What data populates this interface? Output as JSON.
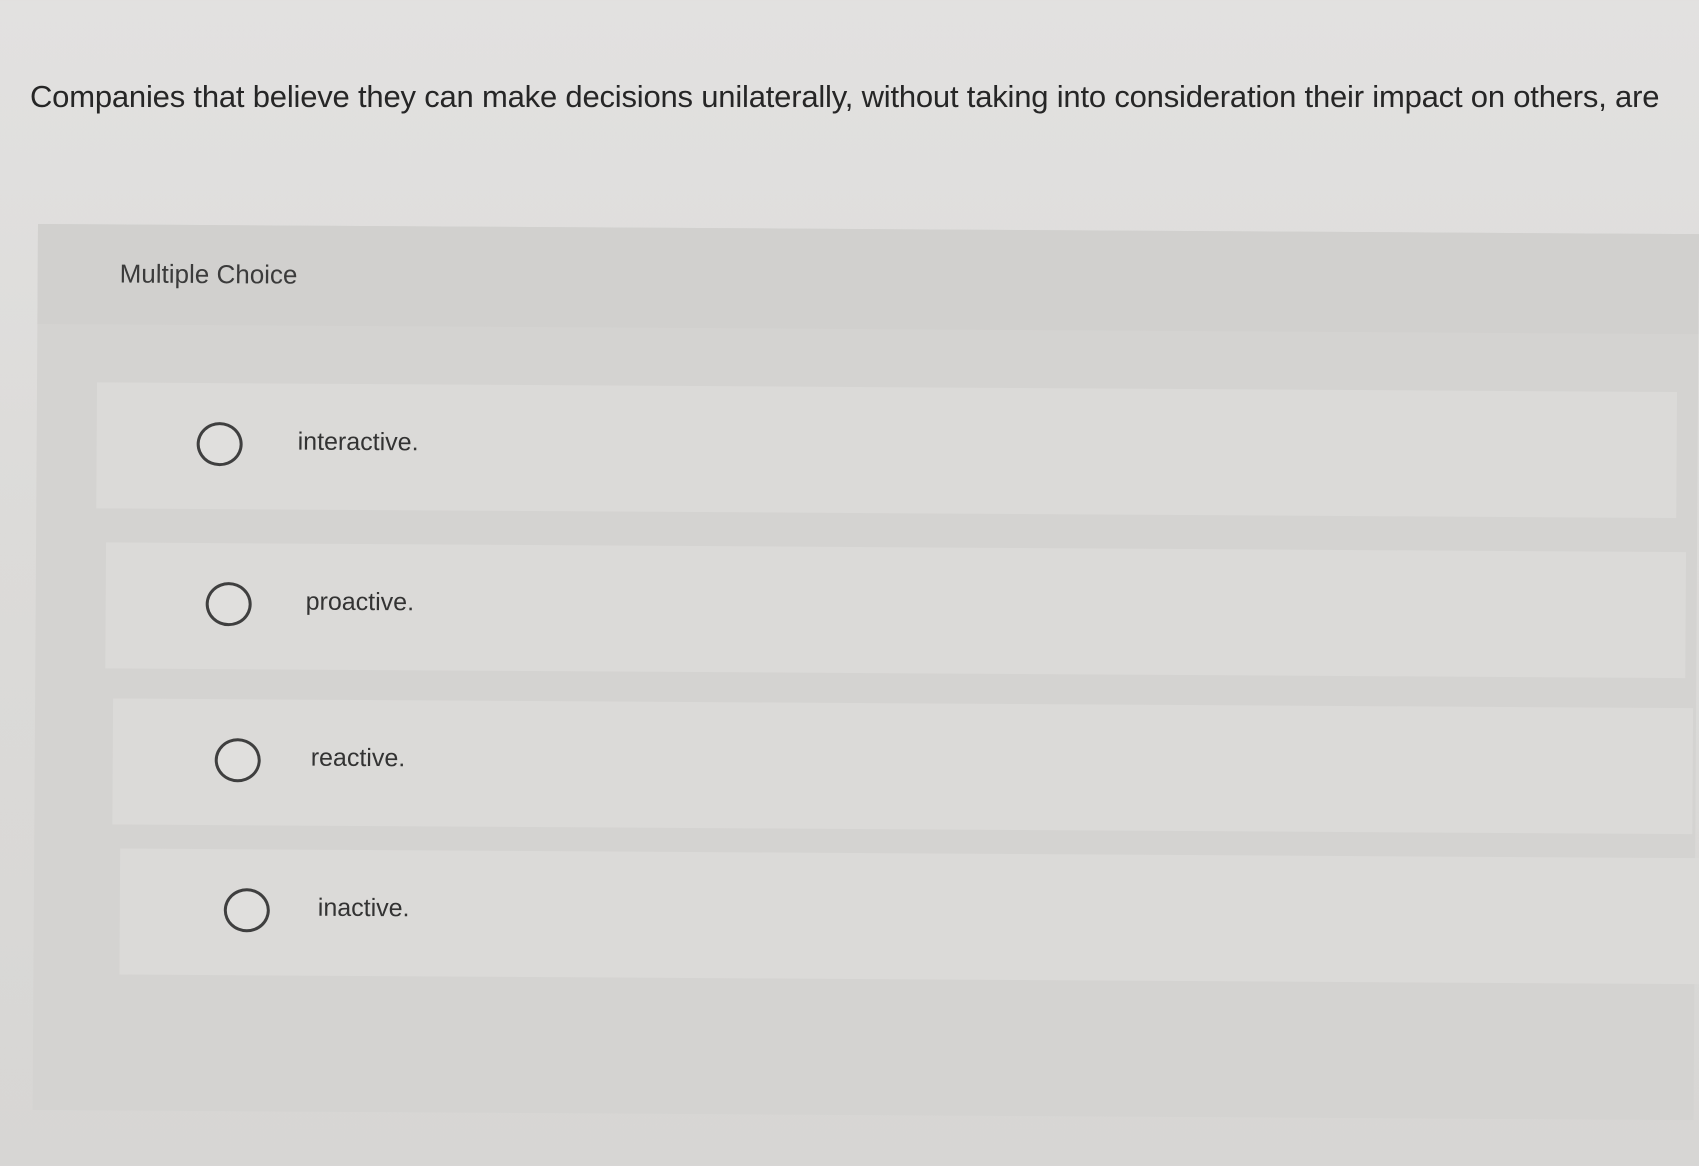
{
  "question": {
    "text": "Companies that believe they can make decisions unilaterally, without taking into consideration their impact on others, are"
  },
  "multiple_choice": {
    "title": "Multiple Choice",
    "options": [
      {
        "label": "interactive.",
        "selected": false
      },
      {
        "label": "proactive.",
        "selected": false
      },
      {
        "label": "reactive.",
        "selected": false
      },
      {
        "label": "inactive.",
        "selected": false
      }
    ]
  },
  "colors": {
    "page_background": "#dedddb",
    "panel_background": "#d4d3d1",
    "option_background": "#dbdad8",
    "text": "#262626",
    "radio_border": "#3f3f3f"
  }
}
